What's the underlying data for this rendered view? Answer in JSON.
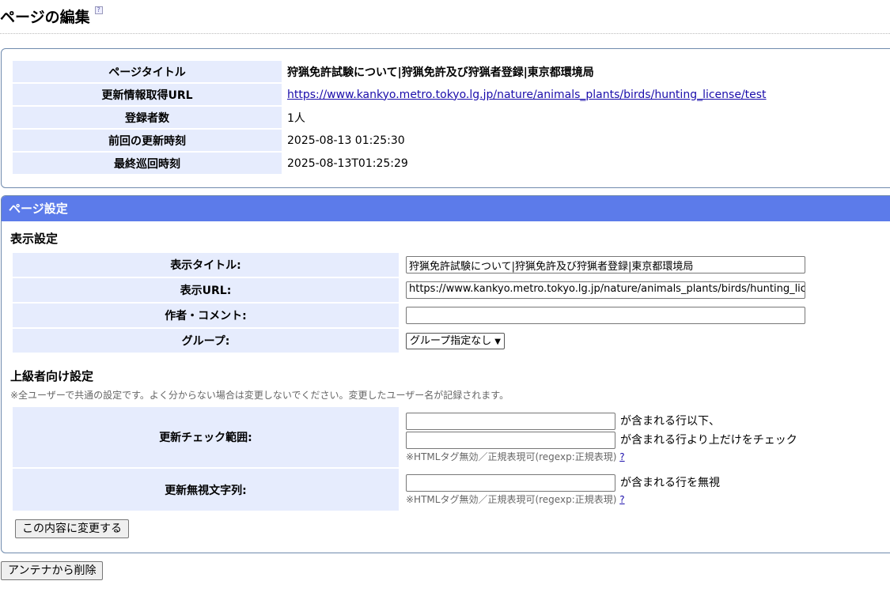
{
  "header": {
    "title": "ページの編集",
    "help_icon": "help-icon"
  },
  "info": {
    "rows": [
      {
        "label": "ページタイトル",
        "value": "狩猟免許試験について|狩猟免許及び狩猟者登録|東京都環境局"
      },
      {
        "label": "更新情報取得URL",
        "value": "https://www.kankyo.metro.tokyo.lg.jp/nature/animals_plants/birds/hunting_license/test"
      },
      {
        "label": "登録者数",
        "value": "1人"
      },
      {
        "label": "前回の更新時刻",
        "value": "2025-08-13 01:25:30"
      },
      {
        "label": "最終巡回時刻",
        "value": "2025-08-13T01:25:29"
      }
    ]
  },
  "settings": {
    "panel_title": "ページ設定",
    "display_section": "表示設定",
    "display_title_label": "表示タイトル:",
    "display_title_value": "狩猟免許試験について|狩猟免許及び狩猟者登録|東京都環境局",
    "display_url_label": "表示URL:",
    "display_url_value": "https://www.kankyo.metro.tokyo.lg.jp/nature/animals_plants/birds/hunting_license/test",
    "author_label": "作者・コメント:",
    "author_value": "",
    "group_label": "グループ:",
    "group_selected": "グループ指定なし",
    "advanced_section": "上級者向け設定",
    "advanced_note": "※全ユーザーで共通の設定です。よく分からない場合は変更しないでください。変更したユーザー名が記録されます。",
    "check_range_label": "更新チェック範囲:",
    "range_start_value": "",
    "range_start_suffix": "が含まれる行以下、",
    "range_end_value": "",
    "range_end_suffix": "が含まれる行より上だけをチェック",
    "regex_note": "※HTMLタグ無効／正規表現可(regexp:正規表現)",
    "regex_help": "?",
    "ignore_label": "更新無視文字列:",
    "ignore_value": "",
    "ignore_suffix": "が含まれる行を無視",
    "submit_label": "この内容に変更する"
  },
  "delete_label": "アンテナから削除"
}
